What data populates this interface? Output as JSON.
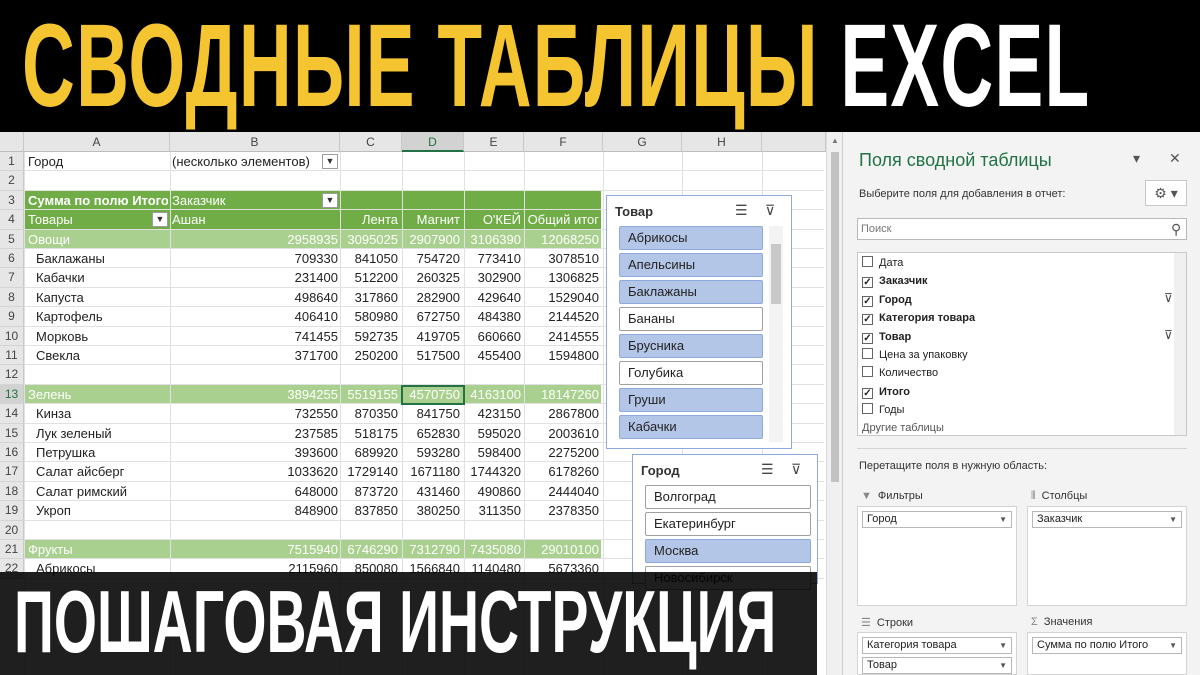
{
  "banner": {
    "title_part1": "СВОДНЫЕ ТАБЛИЦЫ",
    "title_part2": "EXCEL",
    "subtitle": "ПОШАГОВАЯ ИНСТРУКЦИЯ",
    "accent_color": "#f5c431"
  },
  "sheet": {
    "columns": [
      "A",
      "B",
      "C",
      "D",
      "E",
      "F",
      "G",
      "H"
    ],
    "selected_column": "D",
    "selected_row": "13",
    "row_numbers": [
      "1",
      "2",
      "3",
      "4",
      "5",
      "6",
      "7",
      "8",
      "9",
      "10",
      "11",
      "12",
      "13",
      "14",
      "15",
      "16",
      "17",
      "18",
      "19",
      "20",
      "21",
      "22"
    ],
    "filter_label": "Город",
    "filter_value": "(несколько элементов)",
    "sum_label": "Сумма по полю Итого",
    "col_field": "Заказчик",
    "row_field": "Товары",
    "col_headers": [
      "Ашан",
      "Лента",
      "Магнит",
      "О'КЕЙ",
      "Общий итог"
    ],
    "groups": [
      {
        "name": "Овощи",
        "row": "5",
        "values": [
          "2958935",
          "3095025",
          "2907900",
          "3106390",
          "12068250"
        ]
      },
      {
        "name": "Зелень",
        "row": "13",
        "values": [
          "3894255",
          "5519155",
          "4570750",
          "4163100",
          "18147260"
        ]
      },
      {
        "name": "Фрукты",
        "row": "21",
        "values": [
          "7515940",
          "6746290",
          "7312790",
          "7435080",
          "29010100"
        ]
      }
    ],
    "items": [
      {
        "row": "6",
        "name": "Баклажаны",
        "values": [
          "709330",
          "841050",
          "754720",
          "773410",
          "3078510"
        ]
      },
      {
        "row": "7",
        "name": "Кабачки",
        "values": [
          "231400",
          "512200",
          "260325",
          "302900",
          "1306825"
        ]
      },
      {
        "row": "8",
        "name": "Капуста",
        "values": [
          "498640",
          "317860",
          "282900",
          "429640",
          "1529040"
        ]
      },
      {
        "row": "9",
        "name": "Картофель",
        "values": [
          "406410",
          "580980",
          "672750",
          "484380",
          "2144520"
        ]
      },
      {
        "row": "10",
        "name": "Морковь",
        "values": [
          "741455",
          "592735",
          "419705",
          "660660",
          "2414555"
        ]
      },
      {
        "row": "11",
        "name": "Свекла",
        "values": [
          "371700",
          "250200",
          "517500",
          "455400",
          "1594800"
        ]
      },
      {
        "row": "14",
        "name": "Кинза",
        "values": [
          "732550",
          "870350",
          "841750",
          "423150",
          "2867800"
        ]
      },
      {
        "row": "15",
        "name": "Лук зеленый",
        "values": [
          "237585",
          "518175",
          "652830",
          "595020",
          "2003610"
        ]
      },
      {
        "row": "16",
        "name": "Петрушка",
        "values": [
          "393600",
          "689920",
          "593280",
          "598400",
          "2275200"
        ]
      },
      {
        "row": "17",
        "name": "Салат айсберг",
        "values": [
          "1033620",
          "1729140",
          "1671180",
          "1744320",
          "6178260"
        ]
      },
      {
        "row": "18",
        "name": "Салат римский",
        "values": [
          "648000",
          "873720",
          "431460",
          "490860",
          "2444040"
        ]
      },
      {
        "row": "19",
        "name": "Укроп",
        "values": [
          "848900",
          "837850",
          "380250",
          "311350",
          "2378350"
        ]
      },
      {
        "row": "22",
        "name": "Абрикосы",
        "values": [
          "2115960",
          "850080",
          "1566840",
          "1140480",
          "5673360"
        ]
      }
    ]
  },
  "slicer_tovar": {
    "title": "Товар",
    "items": [
      {
        "label": "Абрикосы",
        "selected": true
      },
      {
        "label": "Апельсины",
        "selected": true
      },
      {
        "label": "Баклажаны",
        "selected": true
      },
      {
        "label": "Бананы",
        "selected": false
      },
      {
        "label": "Брусника",
        "selected": true
      },
      {
        "label": "Голубика",
        "selected": false
      },
      {
        "label": "Груши",
        "selected": true
      },
      {
        "label": "Кабачки",
        "selected": true
      }
    ]
  },
  "slicer_gorod": {
    "title": "Город",
    "items": [
      {
        "label": "Волгоград",
        "selected": false
      },
      {
        "label": "Екатеринбург",
        "selected": false
      },
      {
        "label": "Москва",
        "selected": true
      },
      {
        "label": "Новосибирск",
        "selected": false
      }
    ]
  },
  "panel": {
    "title": "Поля сводной таблицы",
    "subtitle": "Выберите поля для добавления в отчет:",
    "search_placeholder": "Поиск",
    "fields": [
      {
        "label": "Дата",
        "checked": false,
        "bold": false,
        "filtered": false
      },
      {
        "label": "Заказчик",
        "checked": true,
        "bold": true,
        "filtered": false
      },
      {
        "label": "Город",
        "checked": true,
        "bold": true,
        "filtered": true
      },
      {
        "label": "Категория товара",
        "checked": true,
        "bold": true,
        "filtered": false
      },
      {
        "label": "Товар",
        "checked": true,
        "bold": true,
        "filtered": true
      },
      {
        "label": "Цена за упаковку",
        "checked": false,
        "bold": false,
        "filtered": false
      },
      {
        "label": "Количество",
        "checked": false,
        "bold": false,
        "filtered": false
      },
      {
        "label": "Итого",
        "checked": true,
        "bold": true,
        "filtered": false
      },
      {
        "label": "Годы",
        "checked": false,
        "bold": false,
        "filtered": false
      }
    ],
    "other_tables": "Другие таблицы",
    "drag_label": "Перетащите поля в нужную область:",
    "filters_label": "Фильтры",
    "columns_label": "Столбцы",
    "rows_label": "Строки",
    "values_label": "Значения",
    "filters_item": "Город",
    "columns_item": "Заказчик",
    "rows_items": [
      "Категория товара",
      "Товар"
    ],
    "values_item": "Сумма по полю Итого"
  }
}
